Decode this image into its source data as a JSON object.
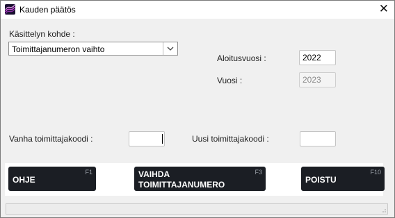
{
  "window": {
    "title": "Kauden päätös",
    "close_glyph": "✕",
    "icon": "app-logo-icon"
  },
  "form": {
    "target_label": "Käsittelyn kohde :",
    "target_value": "Toimittajanumeron vaihto",
    "start_year_label": "Aloitusvuosi :",
    "start_year_value": "2022",
    "year_label": "Vuosi :",
    "year_value": "2023",
    "old_supplier_label": "Vanha toimittajakoodi :",
    "old_supplier_value": "",
    "new_supplier_label": "Uusi toimittajakoodi :",
    "new_supplier_value": ""
  },
  "buttons": {
    "help": {
      "label": "OHJE",
      "key": "F1"
    },
    "change": {
      "label_line1": "VAIHDA",
      "label_line2": "TOIMITTAJANUMERO",
      "key": "F3"
    },
    "exit": {
      "label": "POISTU",
      "key": "F10"
    }
  },
  "status": {
    "text": ""
  },
  "colors": {
    "button_bg": "#1b1e24",
    "logo": "#5a1f6e"
  }
}
